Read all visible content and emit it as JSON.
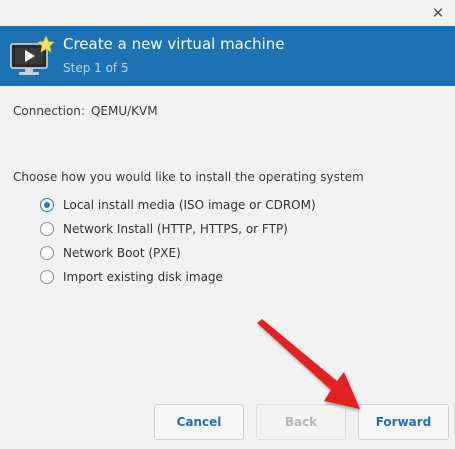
{
  "window": {
    "close_icon": "close-icon"
  },
  "header": {
    "title": "Create a new virtual machine",
    "step": "Step 1 of 5",
    "icon": "virtual-machine-icon",
    "background_color": "#1d72b3"
  },
  "connection": {
    "label": "Connection:",
    "value": "QEMU/KVM"
  },
  "install": {
    "prompt": "Choose how you would like to install the operating system",
    "options": [
      {
        "label": "Local install media (ISO image or CDROM)",
        "selected": true
      },
      {
        "label": "Network Install (HTTP, HTTPS, or FTP)",
        "selected": false
      },
      {
        "label": "Network Boot (PXE)",
        "selected": false
      },
      {
        "label": "Import existing disk image",
        "selected": false
      }
    ]
  },
  "buttons": {
    "cancel": "Cancel",
    "back": "Back",
    "forward": "Forward"
  },
  "annotation": {
    "arrow_color": "#e02020",
    "arrow_icon": "red-arrow-pointer"
  }
}
